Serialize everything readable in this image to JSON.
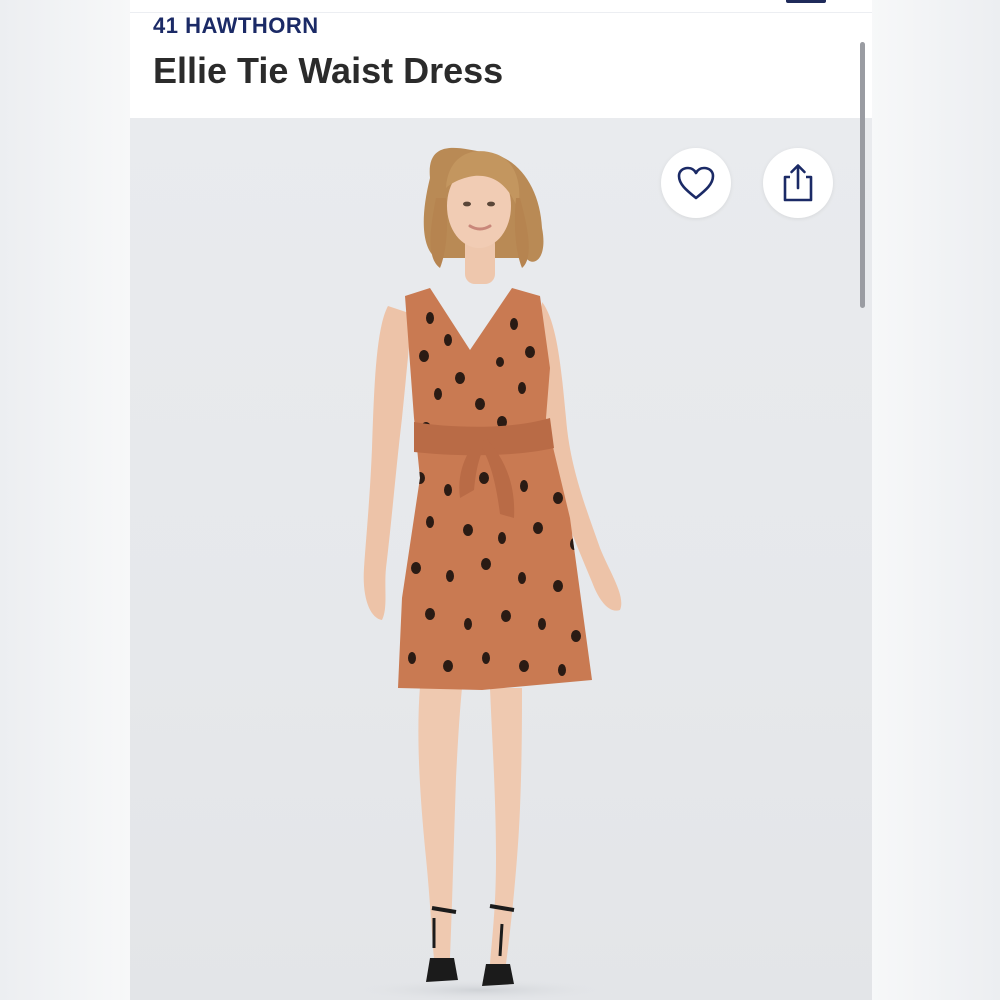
{
  "product": {
    "brand": "41 HAWTHORN",
    "title": "Ellie Tie Waist Dress"
  },
  "actions": {
    "like_icon": "heart-outline-icon",
    "share_icon": "share-upload-icon"
  },
  "colors": {
    "brand": "#1b2a66",
    "title": "#2b2b2b",
    "dress": "#c97a52",
    "dots": "#2a1b14",
    "photo_bg": "#e7e9ec"
  }
}
